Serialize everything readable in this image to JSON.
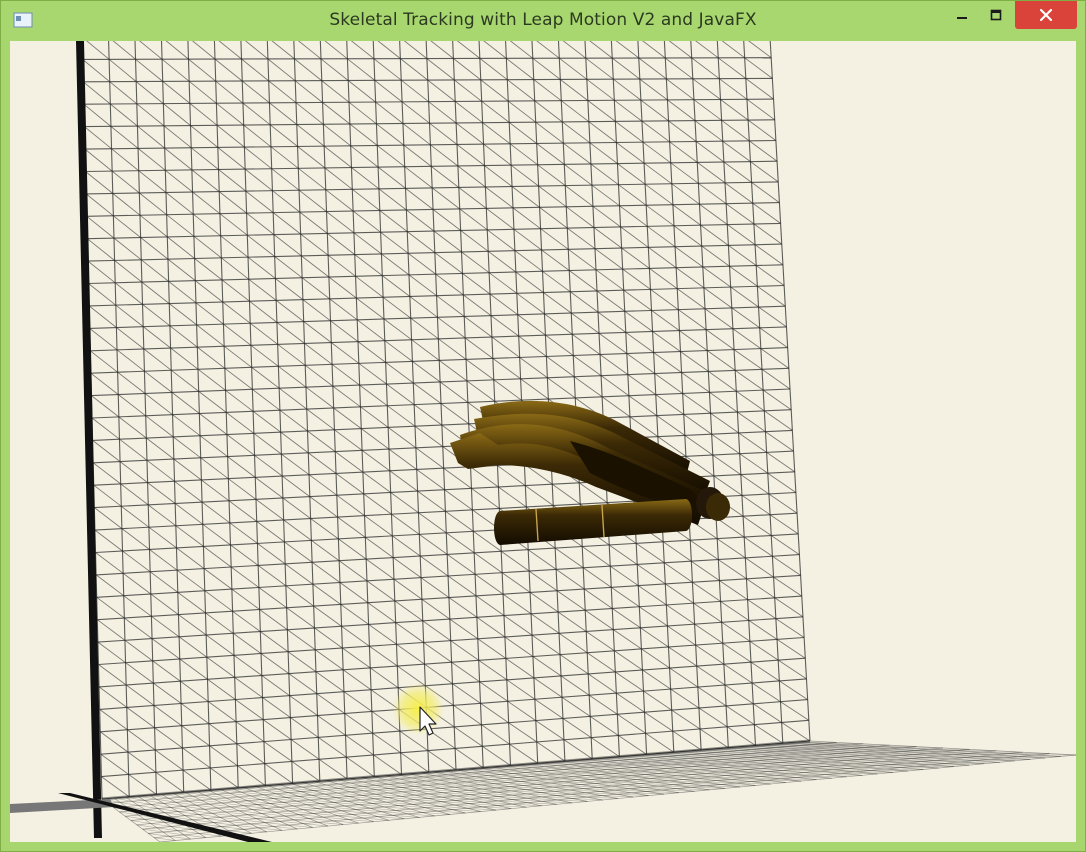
{
  "window": {
    "title": "Skeletal Tracking with Leap Motion V2 and JavaFX",
    "icons": {
      "app": "window-app-icon",
      "minimize": "minimize-icon",
      "maximize": "maximize-icon",
      "close": "close-icon"
    },
    "colors": {
      "frame": "#a9d76f",
      "close_button": "#d9433a",
      "background": "#f4f1e3",
      "grid_line": "#2a2a2a",
      "hand": "#3a2a06"
    }
  }
}
